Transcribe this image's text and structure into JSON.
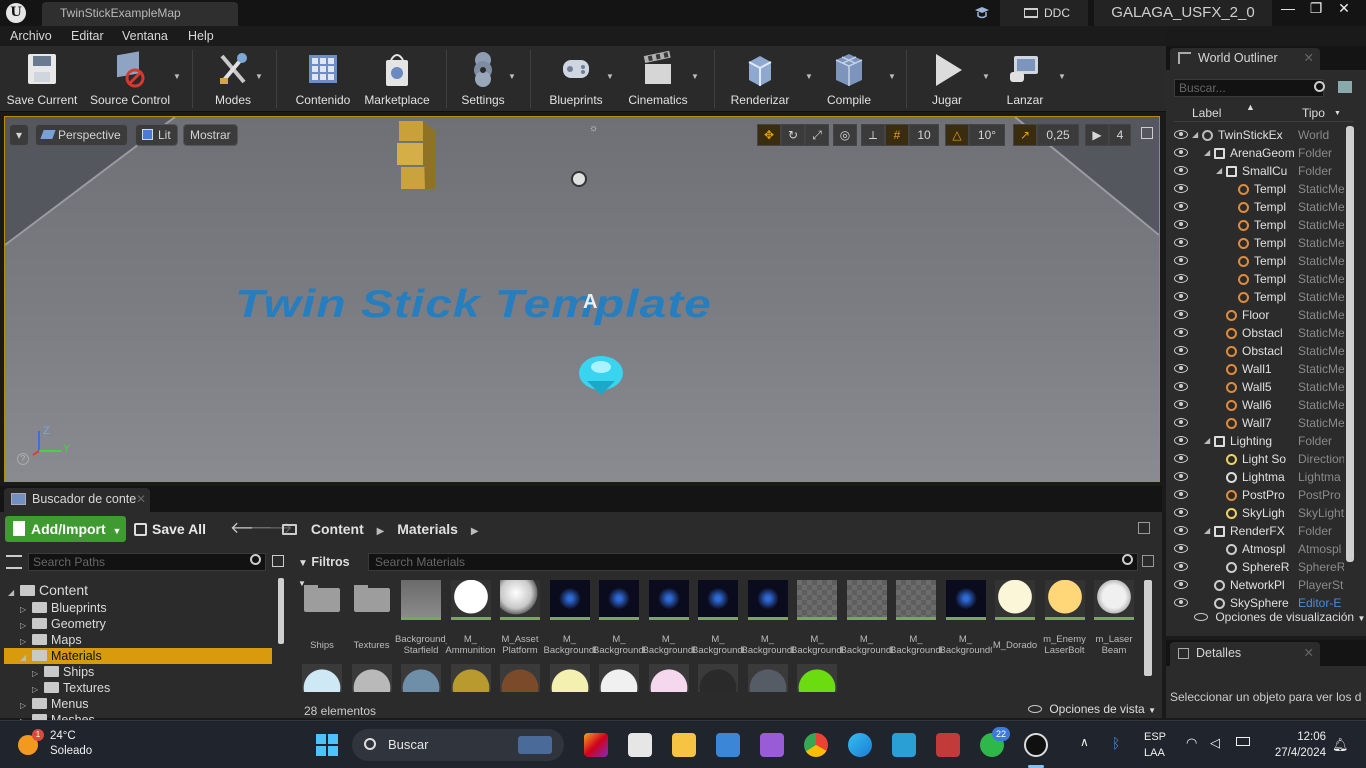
{
  "titlebar": {
    "map_tab": "TwinStickExampleMap",
    "ddc": "DDC",
    "project": "GALAGA_USFX_2_0",
    "minimize": "—",
    "maximize": "❐",
    "close": "✕"
  },
  "menu": [
    "Archivo",
    "Editar",
    "Ventana",
    "Help"
  ],
  "toolbar": {
    "save_current": "Save Current",
    "source_control": "Source Control",
    "modes": "Modes",
    "content": "Contenido",
    "marketplace": "Marketplace",
    "settings": "Settings",
    "blueprints": "Blueprints",
    "cinematics": "Cinematics",
    "render": "Renderizar",
    "compile": "Compile",
    "play": "Jugar",
    "launch": "Lanzar"
  },
  "viewport": {
    "perspective": "Perspective",
    "lit": "Lit",
    "show": "Mostrar",
    "grid_snap": "10",
    "rot_snap": "10°",
    "scale_snap": "0,25",
    "cam_speed": "4",
    "floor_text": "Twin Stick Template",
    "actor_label": "A",
    "axis_x": "Z",
    "axis_y": "Y"
  },
  "content_browser": {
    "tab": "Buscador de conte",
    "add_import": "Add/Import",
    "save_all": "Save All",
    "crumb": [
      "Content",
      "Materials"
    ],
    "search_paths_placeholder": "Search Paths",
    "filters": "Filtros",
    "search_materials_placeholder": "Search Materials",
    "tree": [
      {
        "label": "Content",
        "level": 0,
        "expanded": true
      },
      {
        "label": "Blueprints",
        "level": 1
      },
      {
        "label": "Geometry",
        "level": 1
      },
      {
        "label": "Maps",
        "level": 1
      },
      {
        "label": "Materials",
        "level": 1,
        "selected": true
      },
      {
        "label": "Ships",
        "level": 2
      },
      {
        "label": "Textures",
        "level": 2
      },
      {
        "label": "Menus",
        "level": 1
      },
      {
        "label": "Meshes",
        "level": 1
      }
    ],
    "assets_row1": [
      {
        "label": "Ships",
        "kind": "folder"
      },
      {
        "label": "Textures",
        "kind": "folder"
      },
      {
        "label": "Background_ Starfield",
        "kind": "grey"
      },
      {
        "label": "M_ Ammunition",
        "kind": "white"
      },
      {
        "label": "M_Asset Platform",
        "kind": "sphere"
      },
      {
        "label": "M_ Background0",
        "kind": "space"
      },
      {
        "label": "M_ Background02",
        "kind": "space"
      },
      {
        "label": "M_ Background03",
        "kind": "space"
      },
      {
        "label": "M_ Background04",
        "kind": "space"
      },
      {
        "label": "M_ Background05",
        "kind": "space"
      },
      {
        "label": "M_ Background06",
        "kind": "checker"
      },
      {
        "label": "M_ Background07",
        "kind": "checker"
      },
      {
        "label": "M_ Background08",
        "kind": "checker"
      },
      {
        "label": "M_ Background09",
        "kind": "space"
      },
      {
        "label": "M_Dorado",
        "kind": "cream"
      },
      {
        "label": "m_Enemy LaserBolt",
        "kind": "yellow"
      },
      {
        "label": "m_Laser Beam",
        "kind": "glass"
      }
    ],
    "assets_row2_colors": [
      "#cfe8f5",
      "#b9b9b9",
      "#6f8ea8",
      "#b89a2e",
      "#7a4a2a",
      "#f3f0b0",
      "#f0f0f0",
      "#f6d8ee",
      "#2a2a2a",
      "#555c66",
      "#6bdc10"
    ],
    "items_count": "28 elementos",
    "view_options": "Opciones de vista"
  },
  "outliner": {
    "tab": "World Outliner",
    "search_placeholder": "Buscar...",
    "col_label": "Label",
    "col_type": "Tipo",
    "rows": [
      {
        "label": "TwinStickEx",
        "type": "World",
        "indent": 0
      },
      {
        "label": "ArenaGeom",
        "type": "Folder",
        "indent": 1
      },
      {
        "label": "SmallCu",
        "type": "Folder",
        "indent": 2
      },
      {
        "label": "Templ",
        "type": "StaticMe",
        "indent": 3
      },
      {
        "label": "Templ",
        "type": "StaticMe",
        "indent": 3
      },
      {
        "label": "Templ",
        "type": "StaticMe",
        "indent": 3
      },
      {
        "label": "Templ",
        "type": "StaticMe",
        "indent": 3
      },
      {
        "label": "Templ",
        "type": "StaticMe",
        "indent": 3
      },
      {
        "label": "Templ",
        "type": "StaticMe",
        "indent": 3
      },
      {
        "label": "Templ",
        "type": "StaticMe",
        "indent": 3
      },
      {
        "label": "Floor",
        "type": "StaticMe",
        "indent": 2
      },
      {
        "label": "Obstacl",
        "type": "StaticMe",
        "indent": 2
      },
      {
        "label": "Obstacl",
        "type": "StaticMe",
        "indent": 2
      },
      {
        "label": "Wall1",
        "type": "StaticMe",
        "indent": 2
      },
      {
        "label": "Wall5",
        "type": "StaticMe",
        "indent": 2
      },
      {
        "label": "Wall6",
        "type": "StaticMe",
        "indent": 2
      },
      {
        "label": "Wall7",
        "type": "StaticMe",
        "indent": 2
      },
      {
        "label": "Lighting",
        "type": "Folder",
        "indent": 1
      },
      {
        "label": "Light So",
        "type": "Direction",
        "indent": 2
      },
      {
        "label": "Lightma",
        "type": "Lightma",
        "indent": 2
      },
      {
        "label": "PostPro",
        "type": "PostPro",
        "indent": 2
      },
      {
        "label": "SkyLigh",
        "type": "SkyLight",
        "indent": 2
      },
      {
        "label": "RenderFX",
        "type": "Folder",
        "indent": 1
      },
      {
        "label": "Atmospl",
        "type": "Atmospl",
        "indent": 2
      },
      {
        "label": "SphereR",
        "type": "SphereR",
        "indent": 2
      },
      {
        "label": "NetworkPl",
        "type": "PlayerSt",
        "indent": 1
      },
      {
        "label": "SkySphere",
        "type": "Editor-E",
        "indent": 1
      }
    ],
    "view_options": "Opciones de visualización"
  },
  "details": {
    "tab": "Detalles",
    "message": "Seleccionar un objeto para ver los d"
  },
  "taskbar": {
    "weather_temp": "24°C",
    "weather_text": "Soleado",
    "weather_badge": "1",
    "search": "Buscar",
    "whatsapp_badge": "22",
    "lang1": "ESP",
    "lang2": "LAA",
    "time": "12:06",
    "date": "27/4/2024"
  },
  "colors": {
    "accent_selection": "#d99a0e",
    "add_import_green": "#3f9a32",
    "viewport_border": "#b88b10",
    "floor_text_blue": "#1e7fc6"
  }
}
